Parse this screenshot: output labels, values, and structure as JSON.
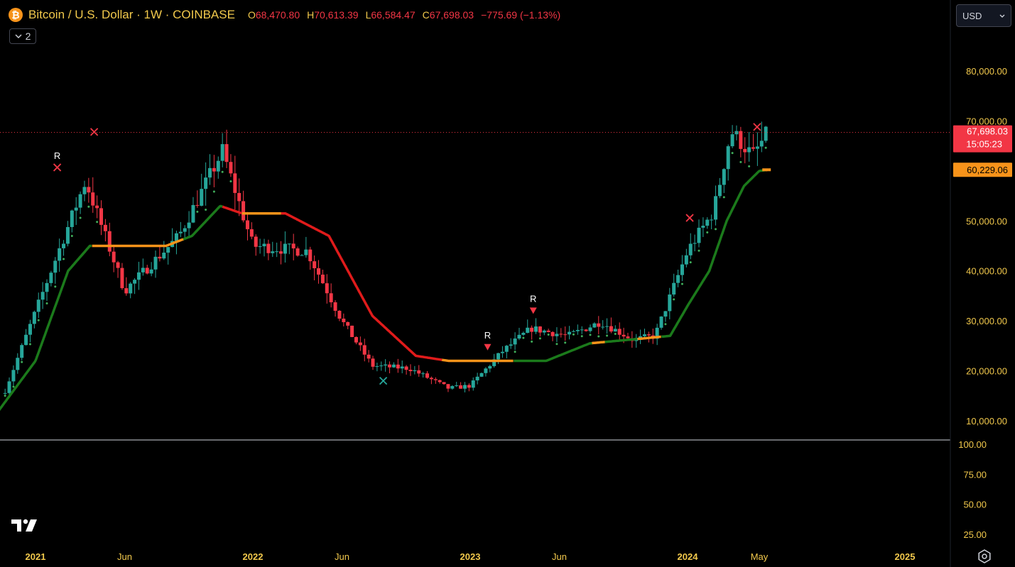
{
  "header": {
    "coin_icon_glyph": "₿",
    "title": "Bitcoin / U.S. Dollar · 1W · COINBASE",
    "ohlc": [
      {
        "k": "O",
        "v": "68,470.80"
      },
      {
        "k": "H",
        "v": "70,613.39"
      },
      {
        "k": "L",
        "v": "66,584.47"
      },
      {
        "k": "C",
        "v": "67,698.03"
      }
    ],
    "change": "−775.69 (−1.13%)"
  },
  "indicators_toggle": {
    "count": "2"
  },
  "currency": {
    "selected": "USD"
  },
  "price_axis": {
    "ticks": [
      {
        "v": 80000,
        "label": "80,000.00"
      },
      {
        "v": 70000,
        "label": "70,000.00"
      },
      {
        "v": 50000,
        "label": "50,000.00"
      },
      {
        "v": 40000,
        "label": "40,000.00"
      },
      {
        "v": 30000,
        "label": "30,000.00"
      },
      {
        "v": 20000,
        "label": "20,000.00"
      },
      {
        "v": 10000,
        "label": "10,000.00"
      }
    ],
    "last_price": {
      "v": 67698.03,
      "label": "67,698.03",
      "countdown": "15:05:23"
    },
    "indicator_value": {
      "v": 60229.06,
      "label": "60,229.06"
    }
  },
  "lower_pane": {
    "ticks": [
      {
        "v": 100,
        "label": "100.00"
      },
      {
        "v": 75,
        "label": "75.00"
      },
      {
        "v": 50,
        "label": "50.00"
      },
      {
        "v": 25,
        "label": "25.00"
      }
    ]
  },
  "time_axis": {
    "ticks": [
      {
        "t": 2021.0,
        "label": "2021",
        "major": true
      },
      {
        "t": 2021.41,
        "label": "Jun",
        "major": false
      },
      {
        "t": 2022.0,
        "label": "2022",
        "major": true
      },
      {
        "t": 2022.41,
        "label": "Jun",
        "major": false
      },
      {
        "t": 2023.0,
        "label": "2023",
        "major": true
      },
      {
        "t": 2023.41,
        "label": "Jun",
        "major": false
      },
      {
        "t": 2024.0,
        "label": "2024",
        "major": true
      },
      {
        "t": 2024.33,
        "label": "May",
        "major": false
      },
      {
        "t": 2025.0,
        "label": "2025",
        "major": true
      }
    ]
  },
  "colors": {
    "up": "#26a69a",
    "down": "#f23645",
    "ma_bull": "#1b7a1b",
    "ma_bear": "#e01b1b",
    "ma_neutral": "#f7931a",
    "label_yellow": "#f2c94c"
  },
  "chart_data": {
    "type": "candlestick",
    "x_range": [
      2020.83,
      2025.25
    ],
    "y_range": [
      5000,
      90000
    ],
    "x_anchor": [
      2020.86,
      2021.23,
      2021.41,
      2021.66,
      2021.86,
      2022.0,
      2022.25,
      2022.41,
      2022.55,
      2022.72,
      2022.9,
      2023.0,
      2023.15,
      2023.28,
      2023.45,
      2023.6,
      2023.75,
      2023.85,
      2024.0,
      2024.12,
      2024.2,
      2024.3,
      2024.37
    ],
    "y_anchor": [
      16000,
      58000,
      36000,
      47000,
      64000,
      45000,
      44000,
      30000,
      21000,
      20500,
      16500,
      17000,
      24000,
      28500,
      27000,
      29800,
      26200,
      27000,
      44000,
      52000,
      68000,
      63000,
      67698
    ],
    "ma_x": [
      2020.83,
      2021.0,
      2021.15,
      2021.25,
      2021.35,
      2021.6,
      2021.72,
      2021.85,
      2021.95,
      2022.15,
      2022.35,
      2022.55,
      2022.75,
      2022.9,
      2023.05,
      2023.2,
      2023.35,
      2023.55,
      2023.8,
      2023.92,
      2024.0,
      2024.1,
      2024.18,
      2024.26,
      2024.33,
      2024.37
    ],
    "ma_y": [
      12000,
      22000,
      40000,
      45000,
      45000,
      45000,
      47000,
      53000,
      51500,
      51500,
      47000,
      31000,
      23000,
      22000,
      22000,
      22000,
      22000,
      25500,
      26500,
      27000,
      33000,
      40000,
      50000,
      57000,
      60000,
      60229
    ],
    "ma_segments": [
      {
        "from": 2020.83,
        "to": 2021.26,
        "regime": "bull"
      },
      {
        "from": 2021.26,
        "to": 2021.68,
        "regime": "neutral"
      },
      {
        "from": 2021.68,
        "to": 2021.86,
        "regime": "bull"
      },
      {
        "from": 2021.86,
        "to": 2021.95,
        "regime": "bear"
      },
      {
        "from": 2021.95,
        "to": 2022.13,
        "regime": "neutral"
      },
      {
        "from": 2022.13,
        "to": 2022.87,
        "regime": "bear"
      },
      {
        "from": 2022.87,
        "to": 2023.2,
        "regime": "neutral"
      },
      {
        "from": 2023.2,
        "to": 2023.56,
        "regime": "bull"
      },
      {
        "from": 2023.56,
        "to": 2023.62,
        "regime": "neutral"
      },
      {
        "from": 2023.62,
        "to": 2023.77,
        "regime": "bull"
      },
      {
        "from": 2023.77,
        "to": 2023.88,
        "regime": "neutral"
      },
      {
        "from": 2023.88,
        "to": 2024.36,
        "regime": "bull"
      },
      {
        "from": 2024.36,
        "to": 2024.37,
        "regime": "neutral"
      }
    ],
    "markers": [
      {
        "t": 2021.1,
        "v": 60700,
        "kind": "cross",
        "color": "#f23645",
        "label": "R"
      },
      {
        "t": 2021.27,
        "v": 67800,
        "kind": "cross",
        "color": "#f23645",
        "label": ""
      },
      {
        "t": 2022.6,
        "v": 18000,
        "kind": "cross",
        "color": "#26a69a",
        "label": ""
      },
      {
        "t": 2023.08,
        "v": 24800,
        "kind": "triangle-down",
        "color": "#f23645",
        "label": "R"
      },
      {
        "t": 2023.29,
        "v": 32100,
        "kind": "triangle-down",
        "color": "#f23645",
        "label": "R"
      },
      {
        "t": 2024.01,
        "v": 50600,
        "kind": "cross",
        "color": "#f23645",
        "label": ""
      },
      {
        "t": 2024.32,
        "v": 68800,
        "kind": "cross",
        "color": "#f23645",
        "label": ""
      }
    ]
  }
}
